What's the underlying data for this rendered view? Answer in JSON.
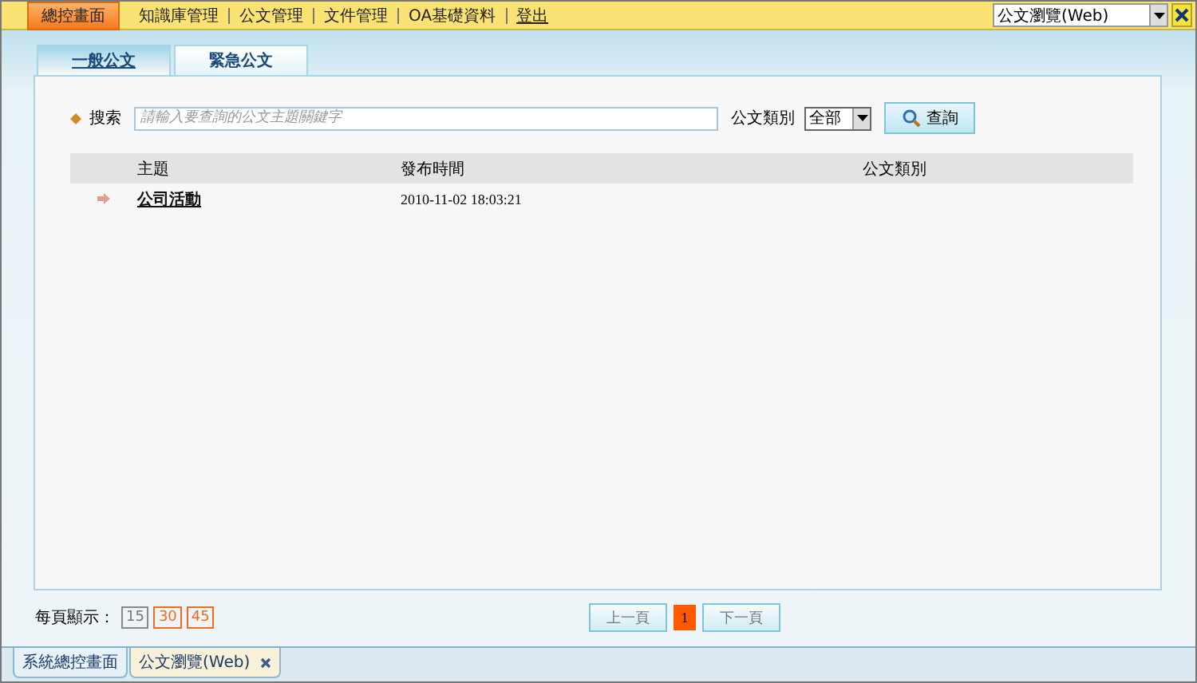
{
  "top_menu": [
    {
      "label": "總控畫面",
      "selected": true
    },
    {
      "label": "知識庫管理",
      "selected": false
    },
    {
      "label": "公文管理",
      "selected": false
    },
    {
      "label": "文件管理",
      "selected": false
    },
    {
      "label": "OA基礎資料",
      "selected": false
    },
    {
      "label": "登出",
      "selected": false,
      "kind": "link"
    }
  ],
  "window_select": {
    "value": "公文瀏覽(Web)"
  },
  "tabs": [
    {
      "label": "一般公文",
      "selected": true
    },
    {
      "label": "緊急公文",
      "selected": false
    }
  ],
  "search": {
    "label": "搜索",
    "placeholder": "請輸入要查詢的公文主題關鍵字",
    "category_label": "公文類別",
    "category_value": "全部",
    "button": "查詢"
  },
  "table": {
    "columns": [
      "主題",
      "發布時間",
      "公文類別"
    ],
    "rows": [
      {
        "title": "公司活動",
        "time": "2010-11-02 18:03:21",
        "category": ""
      }
    ]
  },
  "page_size": {
    "label": "每頁顯示：",
    "options": [
      {
        "label": "15",
        "selected": true
      },
      {
        "label": "30",
        "selected": false
      },
      {
        "label": "45",
        "selected": false
      }
    ]
  },
  "pager": {
    "prev": "上一頁",
    "pages": [
      {
        "label": "1",
        "selected": true
      }
    ],
    "next": "下一頁"
  },
  "bottom_tabs": [
    {
      "label": "系統總控畫面",
      "selected": false,
      "closable": false
    },
    {
      "label": "公文瀏覽(Web)",
      "selected": true,
      "closable": true
    }
  ]
}
